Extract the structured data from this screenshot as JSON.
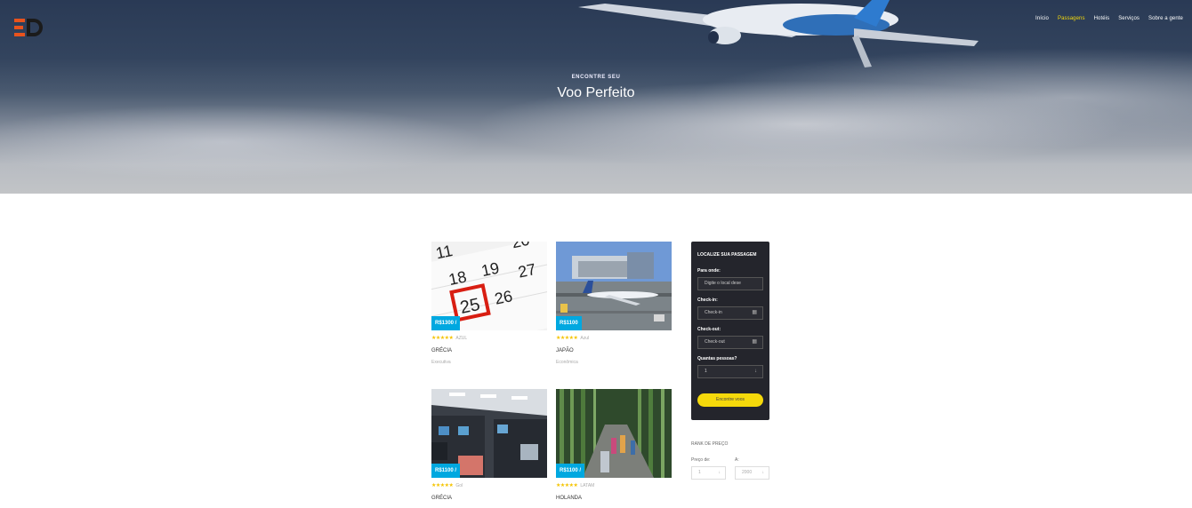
{
  "nav": {
    "items": [
      {
        "label": "Início",
        "active": false
      },
      {
        "label": "Passagens",
        "active": true
      },
      {
        "label": "Hotéis",
        "active": false
      },
      {
        "label": "Serviços",
        "active": false
      },
      {
        "label": "Sobre a gente",
        "active": false
      }
    ]
  },
  "hero": {
    "subtitle": "ENCONTRE SEU",
    "title": "Voo Perfeito"
  },
  "cards": [
    {
      "price": "R$1300 /",
      "airline": "AZUL",
      "destination": "GRÉCIA",
      "class": "Executiva",
      "stars": "★★★★★",
      "image": "calendar-image"
    },
    {
      "price": "R$1100",
      "airline": "Azul",
      "destination": "JAPÃO",
      "class": "Econômica",
      "stars": "★★★★★",
      "image": "airport-image"
    },
    {
      "price": "R$1100 /",
      "airline": "Gol",
      "destination": "GRÉCIA",
      "class": "",
      "stars": "★★★★★",
      "image": "cabin-image"
    },
    {
      "price": "R$1100 /",
      "airline": "LATAM",
      "destination": "HOLANDA",
      "class": "",
      "stars": "★★★★★",
      "image": "bamboo-image"
    }
  ],
  "search": {
    "title": "LOCALIZE SUA PASSAGEM",
    "to_label": "Para onde:",
    "to_placeholder": "Digite o local dese",
    "checkin_label": "Check-in:",
    "checkin_placeholder": "Check-in",
    "checkout_label": "Check-out:",
    "checkout_placeholder": "Check-out",
    "people_label": "Quantas pessoas?",
    "people_value": "1",
    "button": "Encontre voos"
  },
  "price_range": {
    "title": "RANK DE PREÇO",
    "from_label": "Preço de:",
    "to_label": "A:",
    "from_value": "1",
    "to_value": "2000"
  },
  "colors": {
    "accent": "#f5d90b",
    "price_badge": "#00a8e0",
    "panel": "#24252c"
  }
}
